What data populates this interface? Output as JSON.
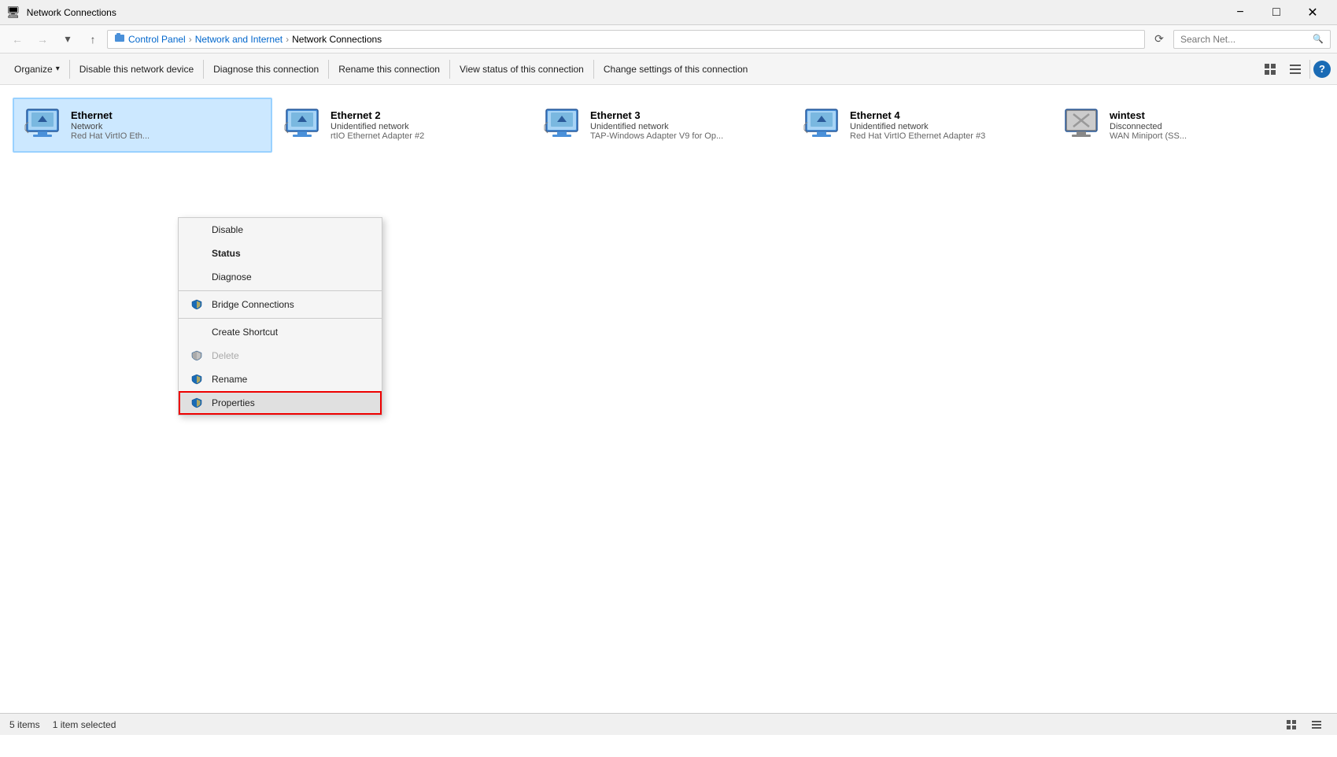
{
  "titleBar": {
    "title": "Network Connections",
    "iconColor": "#0066cc",
    "controls": {
      "minimize": "−",
      "maximize": "□",
      "close": "✕"
    }
  },
  "addressBar": {
    "back": "←",
    "forward": "→",
    "dropdown": "▾",
    "up": "↑",
    "breadcrumb": [
      "Control Panel",
      "Network and Internet",
      "Network Connections"
    ],
    "refreshBtn": "⟳",
    "searchPlaceholder": "Search Net...",
    "searchIcon": "🔍"
  },
  "toolbar": {
    "organize": "Organize",
    "organizeArrow": "▾",
    "disable": "Disable this network device",
    "diagnose": "Diagnose this connection",
    "rename": "Rename this connection",
    "viewStatus": "View status of this connection",
    "changeSettings": "Change settings of this connection",
    "viewIconsBtn": "⊞",
    "viewListBtn": "☰",
    "helpBtn": "?"
  },
  "networkItems": [
    {
      "name": "Ethernet",
      "status": "Network",
      "adapter": "Red Hat VirtIO Eth...",
      "connected": true,
      "selected": true
    },
    {
      "name": "Ethernet 2",
      "status": "Unidentified network",
      "adapter": "rtIO Ethernet Adapter #2",
      "connected": true,
      "selected": false
    },
    {
      "name": "Ethernet 3",
      "status": "Unidentified network",
      "adapter": "TAP-Windows Adapter V9 for Op...",
      "connected": true,
      "selected": false
    },
    {
      "name": "Ethernet 4",
      "status": "Unidentified network",
      "adapter": "Red Hat VirtIO Ethernet Adapter #3",
      "connected": true,
      "selected": false
    },
    {
      "name": "wintest",
      "status": "Disconnected",
      "adapter": "WAN Miniport (SS...",
      "connected": false,
      "selected": false
    }
  ],
  "contextMenu": {
    "items": [
      {
        "label": "Disable",
        "hasShield": false,
        "type": "item",
        "bold": false,
        "disabled": false
      },
      {
        "label": "Status",
        "hasShield": false,
        "type": "item",
        "bold": true,
        "disabled": false
      },
      {
        "label": "Diagnose",
        "hasShield": false,
        "type": "item",
        "bold": false,
        "disabled": false
      },
      {
        "type": "sep"
      },
      {
        "label": "Bridge Connections",
        "hasShield": true,
        "type": "item",
        "bold": false,
        "disabled": false
      },
      {
        "type": "sep"
      },
      {
        "label": "Create Shortcut",
        "hasShield": false,
        "type": "item",
        "bold": false,
        "disabled": false
      },
      {
        "label": "Delete",
        "hasShield": true,
        "type": "item",
        "bold": false,
        "disabled": true
      },
      {
        "label": "Rename",
        "hasShield": true,
        "type": "item",
        "bold": false,
        "disabled": false
      },
      {
        "label": "Properties",
        "hasShield": true,
        "type": "item",
        "bold": false,
        "disabled": false,
        "highlighted": true
      }
    ]
  },
  "statusBar": {
    "itemCount": "5 items",
    "selectedCount": "1 item selected"
  }
}
